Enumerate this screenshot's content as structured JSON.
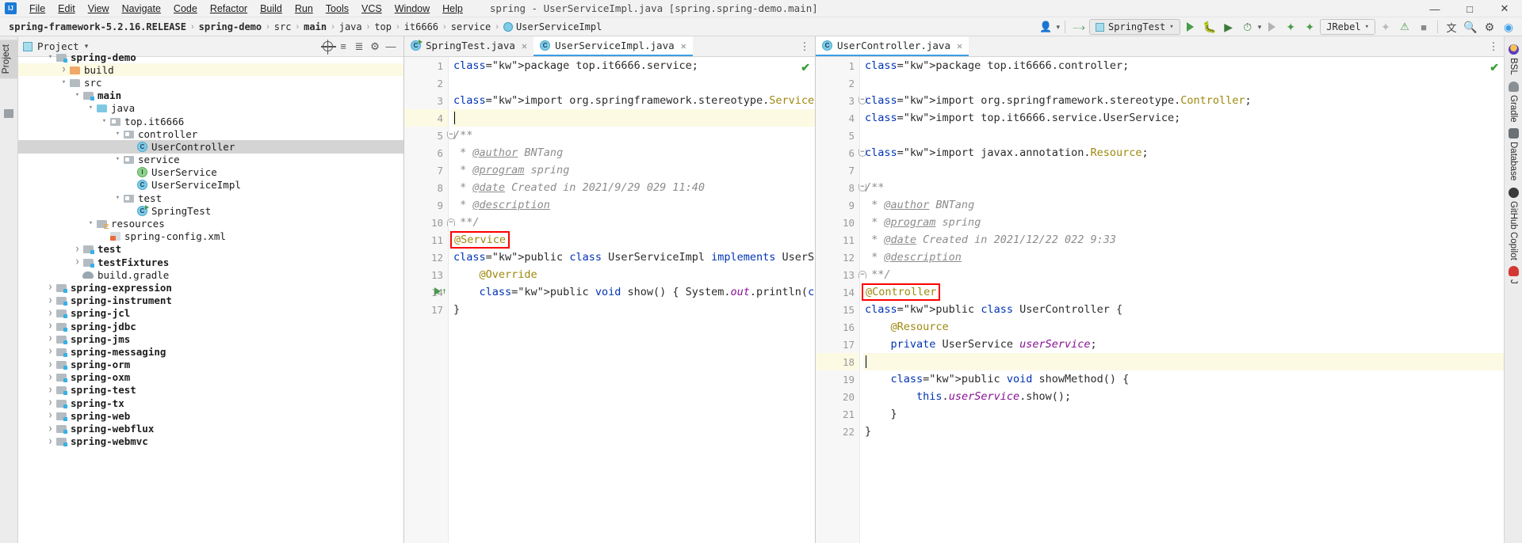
{
  "window": {
    "title": "spring - UserServiceImpl.java [spring.spring-demo.main]",
    "minimize": "—",
    "maximize": "□",
    "close": "✕"
  },
  "menu": {
    "items": [
      "File",
      "Edit",
      "View",
      "Navigate",
      "Code",
      "Refactor",
      "Build",
      "Run",
      "Tools",
      "VCS",
      "Window",
      "Help"
    ]
  },
  "breadcrumb": {
    "items": [
      {
        "label": "spring-framework-5.2.16.RELEASE",
        "bold": true,
        "icon": ""
      },
      {
        "label": "spring-demo",
        "bold": true,
        "icon": ""
      },
      {
        "label": "src",
        "bold": false,
        "icon": ""
      },
      {
        "label": "main",
        "bold": true,
        "icon": ""
      },
      {
        "label": "java",
        "bold": false,
        "icon": ""
      },
      {
        "label": "top",
        "bold": false,
        "icon": ""
      },
      {
        "label": "it6666",
        "bold": false,
        "icon": ""
      },
      {
        "label": "service",
        "bold": false,
        "icon": ""
      },
      {
        "label": "UserServiceImpl",
        "bold": false,
        "icon": "class-icon"
      }
    ],
    "separator": "›"
  },
  "toolbar": {
    "user_icon": "user-icon",
    "hammer_icon": "build-hammer-icon",
    "run_config": "SpringTest",
    "run_label": "run-button",
    "debug_label": "debug-button",
    "coverage_label": "run-with-coverage-button",
    "profiler_label": "profiler-button",
    "jrebel_label": "JRebel",
    "stop_label": "stop-button",
    "translate_label": "translate-button",
    "search_label": "search-everywhere-button",
    "settings_label": "settings-button"
  },
  "left_rail": {
    "project_label": "Project",
    "favorites_label": "favorites-icon"
  },
  "project_panel": {
    "title": "Project",
    "chevron": "▾",
    "locate_icon": "locate-icon",
    "expand_icon": "expand-all-icon",
    "collapse_icon": "collapse-all-icon",
    "settings_icon": "gear-icon",
    "hide_icon": "hide-icon",
    "tree": [
      {
        "indent": 2,
        "arrow": "▾",
        "icon": "module-folder",
        "label": "spring-demo",
        "bold": true,
        "state": "cut"
      },
      {
        "indent": 3,
        "arrow": "›",
        "icon": "folder-orange",
        "label": "build",
        "bold": false,
        "state": "highlight"
      },
      {
        "indent": 3,
        "arrow": "▾",
        "icon": "folder-gray",
        "label": "src",
        "bold": false,
        "state": ""
      },
      {
        "indent": 4,
        "arrow": "▾",
        "icon": "module-folder",
        "label": "main",
        "bold": true,
        "state": ""
      },
      {
        "indent": 5,
        "arrow": "▾",
        "icon": "folder-blue",
        "label": "java",
        "bold": false,
        "state": ""
      },
      {
        "indent": 6,
        "arrow": "▾",
        "icon": "package",
        "label": "top.it6666",
        "bold": false,
        "state": ""
      },
      {
        "indent": 7,
        "arrow": "▾",
        "icon": "package",
        "label": "controller",
        "bold": false,
        "state": ""
      },
      {
        "indent": 8,
        "arrow": "",
        "icon": "class",
        "label": "UserController",
        "bold": false,
        "state": "selected"
      },
      {
        "indent": 7,
        "arrow": "▾",
        "icon": "package",
        "label": "service",
        "bold": false,
        "state": ""
      },
      {
        "indent": 8,
        "arrow": "",
        "icon": "interface",
        "label": "UserService",
        "bold": false,
        "state": ""
      },
      {
        "indent": 8,
        "arrow": "",
        "icon": "class",
        "label": "UserServiceImpl",
        "bold": false,
        "state": ""
      },
      {
        "indent": 7,
        "arrow": "▾",
        "icon": "package",
        "label": "test",
        "bold": false,
        "state": ""
      },
      {
        "indent": 8,
        "arrow": "",
        "icon": "class-runnable",
        "label": "SpringTest",
        "bold": false,
        "state": ""
      },
      {
        "indent": 5,
        "arrow": "▾",
        "icon": "resources-folder",
        "label": "resources",
        "bold": false,
        "state": ""
      },
      {
        "indent": 6,
        "arrow": "",
        "icon": "xml",
        "label": "spring-config.xml",
        "bold": false,
        "state": ""
      },
      {
        "indent": 4,
        "arrow": "›",
        "icon": "module-folder",
        "label": "test",
        "bold": true,
        "state": ""
      },
      {
        "indent": 4,
        "arrow": "›",
        "icon": "module-folder",
        "label": "testFixtures",
        "bold": true,
        "state": ""
      },
      {
        "indent": 4,
        "arrow": "",
        "icon": "gradle",
        "label": "build.gradle",
        "bold": false,
        "state": ""
      },
      {
        "indent": 2,
        "arrow": "›",
        "icon": "module-folder",
        "label": "spring-expression",
        "bold": true,
        "state": ""
      },
      {
        "indent": 2,
        "arrow": "›",
        "icon": "module-folder",
        "label": "spring-instrument",
        "bold": true,
        "state": ""
      },
      {
        "indent": 2,
        "arrow": "›",
        "icon": "module-folder",
        "label": "spring-jcl",
        "bold": true,
        "state": ""
      },
      {
        "indent": 2,
        "arrow": "›",
        "icon": "module-folder",
        "label": "spring-jdbc",
        "bold": true,
        "state": ""
      },
      {
        "indent": 2,
        "arrow": "›",
        "icon": "module-folder",
        "label": "spring-jms",
        "bold": true,
        "state": ""
      },
      {
        "indent": 2,
        "arrow": "›",
        "icon": "module-folder",
        "label": "spring-messaging",
        "bold": true,
        "state": ""
      },
      {
        "indent": 2,
        "arrow": "›",
        "icon": "module-folder",
        "label": "spring-orm",
        "bold": true,
        "state": ""
      },
      {
        "indent": 2,
        "arrow": "›",
        "icon": "module-folder",
        "label": "spring-oxm",
        "bold": true,
        "state": ""
      },
      {
        "indent": 2,
        "arrow": "›",
        "icon": "module-folder",
        "label": "spring-test",
        "bold": true,
        "state": ""
      },
      {
        "indent": 2,
        "arrow": "›",
        "icon": "module-folder",
        "label": "spring-tx",
        "bold": true,
        "state": ""
      },
      {
        "indent": 2,
        "arrow": "›",
        "icon": "module-folder",
        "label": "spring-web",
        "bold": true,
        "state": ""
      },
      {
        "indent": 2,
        "arrow": "›",
        "icon": "module-folder",
        "label": "spring-webflux",
        "bold": true,
        "state": ""
      },
      {
        "indent": 2,
        "arrow": "›",
        "icon": "module-folder",
        "label": "spring-webmvc",
        "bold": true,
        "state": ""
      }
    ]
  },
  "left_editor": {
    "tabs": [
      {
        "label": "SpringTest.java",
        "icon": "class-runnable",
        "active": false,
        "close": "✕"
      },
      {
        "label": "UserServiceImpl.java",
        "icon": "class",
        "active": true,
        "close": "✕"
      }
    ],
    "inspection_mark": "✔",
    "line_numbers": [
      "1",
      "2",
      "3",
      "4",
      "5",
      "6",
      "7",
      "8",
      "9",
      "10",
      "11",
      "12",
      "13",
      "14",
      "17"
    ],
    "lines": [
      "package top.it6666.service;",
      "",
      "import org.springframework.stereotype.Service;",
      "",
      "/**",
      " * @author BNTang",
      " * @program spring",
      " * @date Created in 2021/9/29 029 11:40",
      " * @description",
      " **/",
      "@Service",
      "public class UserServiceImpl implements UserService {",
      "    @Override",
      "    public void show() { System.out.println(\"Hello Spring\"); }",
      "}"
    ],
    "highlight_annotation": "@Service",
    "highlight_color": "#ff0000",
    "caret_line": 4
  },
  "right_editor": {
    "tabs": [
      {
        "label": "UserController.java",
        "icon": "class",
        "active": true,
        "close": "✕"
      }
    ],
    "inspection_mark": "✔",
    "line_numbers": [
      "1",
      "2",
      "3",
      "4",
      "5",
      "6",
      "7",
      "8",
      "9",
      "10",
      "11",
      "12",
      "13",
      "14",
      "15",
      "16",
      "17",
      "18",
      "19",
      "20",
      "21",
      "22"
    ],
    "lines": [
      "package top.it6666.controller;",
      "",
      "import org.springframework.stereotype.Controller;",
      "import top.it6666.service.UserService;",
      "",
      "import javax.annotation.Resource;",
      "",
      "/**",
      " * @author BNTang",
      " * @program spring",
      " * @date Created in 2021/12/22 022 9:33",
      " * @description",
      " **/",
      "@Controller",
      "public class UserController {",
      "    @Resource",
      "    private UserService userService;",
      "",
      "    public void showMethod() {",
      "        this.userService.show();",
      "    }",
      "}"
    ],
    "highlight_annotation": "@Controller",
    "highlight_color": "#ff0000",
    "caret_line": 18
  },
  "right_rail": {
    "items": [
      {
        "label": "BSL",
        "icon": "bsl-icon"
      },
      {
        "label": "Gradle",
        "icon": "gradle-icon"
      },
      {
        "label": "Database",
        "icon": "database-icon"
      },
      {
        "label": "GitHub Copilot",
        "icon": "github-copilot-icon"
      },
      {
        "label": "J",
        "icon": "jenkins-icon"
      }
    ]
  },
  "colors": {
    "keyword": "#0033b3",
    "string": "#067d17",
    "annotation": "#9e880d",
    "comment": "#8c8c8c",
    "accent": "#3b9ee5",
    "highlight_box": "#ff0000",
    "caret_line_bg": "#fcfae3"
  }
}
